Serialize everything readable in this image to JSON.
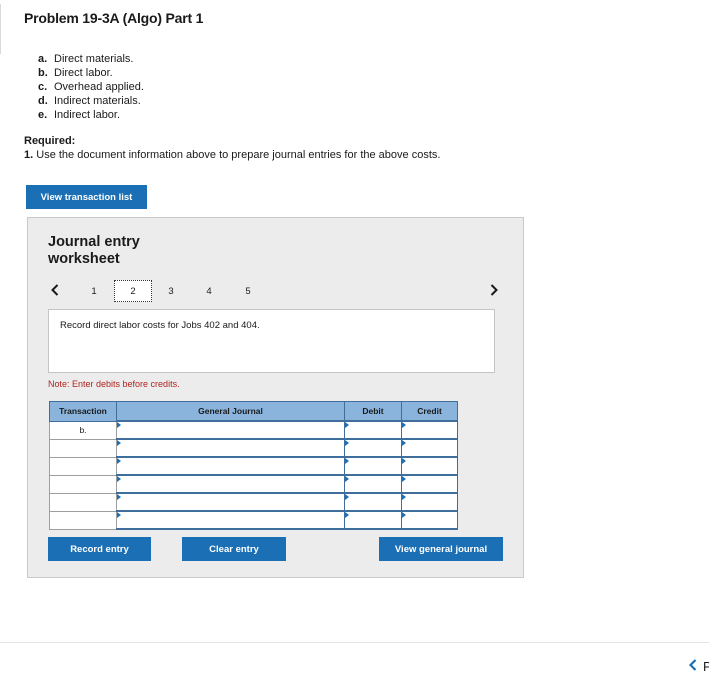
{
  "problem_title": "Problem 19-3A (Algo) Part 1",
  "costs": [
    {
      "letter": "a.",
      "text": "Direct materials."
    },
    {
      "letter": "b.",
      "text": "Direct labor."
    },
    {
      "letter": "c.",
      "text": "Overhead applied."
    },
    {
      "letter": "d.",
      "text": "Indirect materials."
    },
    {
      "letter": "e.",
      "text": "Indirect labor."
    }
  ],
  "required": {
    "label": "Required:",
    "number": "1.",
    "text": "Use the document information above to prepare journal entries for the above costs."
  },
  "buttons": {
    "view_transactions": "View transaction list",
    "record_entry": "Record entry",
    "clear_entry": "Clear entry",
    "view_general_journal": "View general journal"
  },
  "worksheet": {
    "title": "Journal entry worksheet",
    "pages": [
      "1",
      "2",
      "3",
      "4",
      "5"
    ],
    "active_page": "2",
    "prev_icon": "chevron-left",
    "next_icon": "chevron-right",
    "instruction": "Record direct labor costs for Jobs 402 and 404.",
    "note": "Note: Enter debits before credits."
  },
  "journal_table": {
    "headers": [
      "Transaction",
      "General Journal",
      "Debit",
      "Credit"
    ],
    "rows": [
      {
        "transaction": "b.",
        "account": "",
        "debit": "",
        "credit": ""
      },
      {
        "transaction": "",
        "account": "",
        "debit": "",
        "credit": ""
      },
      {
        "transaction": "",
        "account": "",
        "debit": "",
        "credit": ""
      },
      {
        "transaction": "",
        "account": "",
        "debit": "",
        "credit": ""
      },
      {
        "transaction": "",
        "account": "",
        "debit": "",
        "credit": ""
      },
      {
        "transaction": "",
        "account": "",
        "debit": "",
        "credit": ""
      }
    ]
  },
  "footer_nav": {
    "prev_icon": "chevron-left",
    "partial_text": "P"
  },
  "colors": {
    "primary_button": "#1a6fb5",
    "table_header": "#8ab4dc",
    "table_border": "#3f6e9d",
    "note_red": "#b0231f",
    "worksheet_bg": "#ececec"
  }
}
